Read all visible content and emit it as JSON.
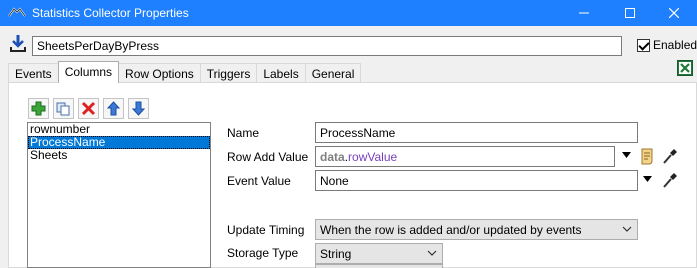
{
  "window": {
    "title": "Statistics Collector Properties"
  },
  "header": {
    "name_value": "SheetsPerDayByPress",
    "enabled_label": "Enabled",
    "enabled_checked": true
  },
  "tabs": [
    {
      "label": "Events"
    },
    {
      "label": "Columns",
      "active": true
    },
    {
      "label": "Row Options"
    },
    {
      "label": "Triggers"
    },
    {
      "label": "Labels"
    },
    {
      "label": "General"
    }
  ],
  "columns_list": {
    "items": [
      "rownumber",
      "ProcessName",
      "Sheets"
    ],
    "selected_index": 1
  },
  "toolbar": {
    "icons": [
      "add-icon",
      "duplicate-icon",
      "delete-icon",
      "move-up-icon",
      "move-down-icon"
    ]
  },
  "form": {
    "name": {
      "label": "Name",
      "value": "ProcessName"
    },
    "row_add_value": {
      "label": "Row Add Value",
      "code_object": "data",
      "code_dot": ".",
      "code_property": "rowValue"
    },
    "event_value": {
      "label": "Event Value",
      "value": "None"
    },
    "update_timing": {
      "label": "Update Timing",
      "value": "When the row is added and/or updated by events"
    },
    "storage_type": {
      "label": "Storage Type",
      "value": "String"
    }
  },
  "colors": {
    "titlebar": "#1e80ff",
    "selection": "#0078d7"
  }
}
